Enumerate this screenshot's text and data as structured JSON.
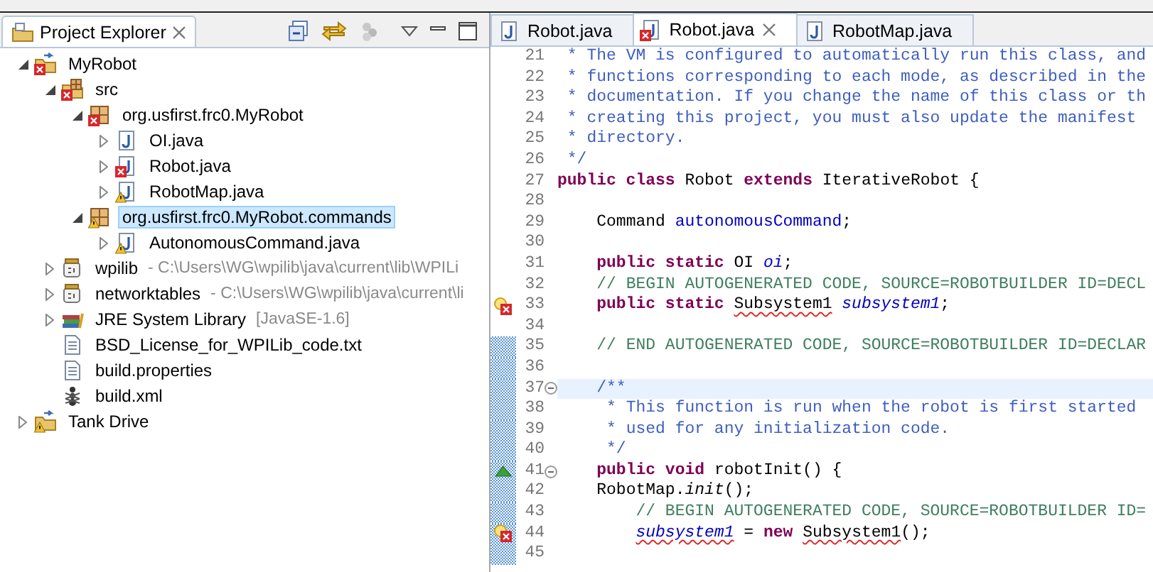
{
  "explorer": {
    "title": "Project Explorer",
    "tree": [
      {
        "label": "MyRobot",
        "kind": "project",
        "has_error": true,
        "has_warning": false,
        "expanded": true,
        "selected": false,
        "children": [
          {
            "label": "src",
            "kind": "source-folder",
            "has_error": true,
            "has_warning": false,
            "expanded": true,
            "selected": false,
            "children": [
              {
                "label": "org.usfirst.frc0.MyRobot",
                "kind": "package",
                "has_error": true,
                "has_warning": false,
                "expanded": true,
                "selected": false,
                "children": [
                  {
                    "label": "OI.java",
                    "kind": "java-file",
                    "has_error": false,
                    "has_warning": false,
                    "expanded": false,
                    "selected": false
                  },
                  {
                    "label": "Robot.java",
                    "kind": "java-file",
                    "has_error": true,
                    "has_warning": false,
                    "expanded": false,
                    "selected": false
                  },
                  {
                    "label": "RobotMap.java",
                    "kind": "java-file",
                    "has_error": false,
                    "has_warning": true,
                    "expanded": false,
                    "selected": false
                  }
                ]
              },
              {
                "label": "org.usfirst.frc0.MyRobot.commands",
                "kind": "package",
                "has_error": false,
                "has_warning": true,
                "expanded": true,
                "selected": true,
                "children": [
                  {
                    "label": "AutonomousCommand.java",
                    "kind": "java-file",
                    "has_error": false,
                    "has_warning": true,
                    "expanded": false,
                    "selected": false
                  }
                ]
              }
            ]
          },
          {
            "label": "wpilib",
            "kind": "library",
            "detail": "- C:\\Users\\WG\\wpilib\\java\\current\\lib\\WPILi",
            "has_error": false,
            "has_warning": false,
            "expanded": false,
            "selected": false
          },
          {
            "label": "networktables",
            "kind": "library",
            "detail": "- C:\\Users\\WG\\wpilib\\java\\current\\li",
            "has_error": false,
            "has_warning": false,
            "expanded": false,
            "selected": false
          },
          {
            "label": "JRE System Library",
            "kind": "jre",
            "detail": "[JavaSE-1.6]",
            "has_error": false,
            "has_warning": false,
            "expanded": false,
            "selected": false
          },
          {
            "label": "BSD_License_for_WPILib_code.txt",
            "kind": "text-file",
            "has_error": false,
            "has_warning": false,
            "selected": false
          },
          {
            "label": "build.properties",
            "kind": "text-file",
            "has_error": false,
            "has_warning": false,
            "selected": false
          },
          {
            "label": "build.xml",
            "kind": "xml-file",
            "has_error": false,
            "has_warning": false,
            "selected": false
          }
        ]
      },
      {
        "label": "Tank Drive",
        "kind": "project",
        "has_error": false,
        "has_warning": true,
        "expanded": false,
        "selected": false
      }
    ]
  },
  "editor": {
    "tabs": [
      {
        "label": "Robot.java",
        "selected": false,
        "has_error": false
      },
      {
        "label": "Robot.java",
        "selected": true,
        "has_error": true
      },
      {
        "label": "RobotMap.java",
        "selected": false,
        "has_error": false
      }
    ],
    "lines": [
      {
        "number": "21",
        "changed": false,
        "current": false,
        "foldable": false,
        "has_error": false,
        "overridden": false,
        "tokens": [
          {
            "kind": "javadoc",
            "text": " * The VM is configured to automatically run this class, and"
          }
        ]
      },
      {
        "number": "22",
        "changed": false,
        "current": false,
        "foldable": false,
        "has_error": false,
        "overridden": false,
        "tokens": [
          {
            "kind": "javadoc",
            "text": " * functions corresponding to each mode, as described in the"
          }
        ]
      },
      {
        "number": "23",
        "changed": false,
        "current": false,
        "foldable": false,
        "has_error": false,
        "overridden": false,
        "tokens": [
          {
            "kind": "javadoc",
            "text": " * documentation. If you change the name of this class or th"
          }
        ]
      },
      {
        "number": "24",
        "changed": false,
        "current": false,
        "foldable": false,
        "has_error": false,
        "overridden": false,
        "tokens": [
          {
            "kind": "javadoc",
            "text": " * creating this project, you must also update the manifest"
          }
        ]
      },
      {
        "number": "25",
        "changed": false,
        "current": false,
        "foldable": false,
        "has_error": false,
        "overridden": false,
        "tokens": [
          {
            "kind": "javadoc",
            "text": " * directory."
          }
        ]
      },
      {
        "number": "26",
        "changed": false,
        "current": false,
        "foldable": false,
        "has_error": false,
        "overridden": false,
        "tokens": [
          {
            "kind": "javadoc",
            "text": " */"
          }
        ]
      },
      {
        "number": "27",
        "changed": false,
        "current": false,
        "foldable": false,
        "has_error": false,
        "overridden": false,
        "tokens": [
          {
            "kind": "keyword",
            "text": "public class"
          },
          {
            "kind": "plain",
            "text": " Robot "
          },
          {
            "kind": "keyword",
            "text": "extends"
          },
          {
            "kind": "plain",
            "text": " IterativeRobot {"
          }
        ]
      },
      {
        "number": "28",
        "changed": false,
        "current": false,
        "foldable": false,
        "has_error": false,
        "overridden": false
      },
      {
        "number": "29",
        "changed": false,
        "current": false,
        "foldable": false,
        "has_error": false,
        "overridden": false,
        "tokens": [
          {
            "kind": "plain",
            "text": "    Command "
          },
          {
            "kind": "field",
            "text": "autonomousCommand"
          },
          {
            "kind": "plain",
            "text": ";"
          }
        ]
      },
      {
        "number": "30",
        "changed": false,
        "current": false,
        "foldable": false,
        "has_error": false,
        "overridden": false
      },
      {
        "number": "31",
        "changed": false,
        "current": false,
        "foldable": false,
        "has_error": false,
        "overridden": false,
        "tokens": [
          {
            "kind": "keyword",
            "text": "    public static"
          },
          {
            "kind": "plain",
            "text": " OI "
          },
          {
            "kind": "static-field",
            "text": "oi"
          },
          {
            "kind": "plain",
            "text": ";"
          }
        ]
      },
      {
        "number": "32",
        "changed": false,
        "current": false,
        "foldable": false,
        "has_error": false,
        "overridden": false,
        "tokens": [
          {
            "kind": "comment",
            "text": "    // BEGIN AUTOGENERATED CODE, SOURCE=ROBOTBUILDER ID=DECL"
          }
        ]
      },
      {
        "number": "33",
        "changed": false,
        "current": false,
        "foldable": false,
        "has_error": true,
        "overridden": false,
        "tokens": [
          {
            "kind": "keyword",
            "text": "    public static"
          },
          {
            "kind": "plain",
            "text": " Subsystem1",
            "squiggle": true
          },
          {
            "kind": "static-field",
            "text": " subsystem1"
          },
          {
            "kind": "plain",
            "text": ";"
          }
        ]
      },
      {
        "number": "34",
        "changed": false,
        "current": false,
        "foldable": false,
        "has_error": false,
        "overridden": false
      },
      {
        "number": "35",
        "changed": true,
        "current": false,
        "foldable": false,
        "has_error": false,
        "overridden": false,
        "tokens": [
          {
            "kind": "comment",
            "text": "    // END AUTOGENERATED CODE, SOURCE=ROBOTBUILDER ID=DECLAR"
          }
        ]
      },
      {
        "number": "36",
        "changed": true,
        "current": false,
        "foldable": false,
        "has_error": false,
        "overridden": false
      },
      {
        "number": "37",
        "changed": true,
        "current": true,
        "foldable": true,
        "has_error": false,
        "overridden": false,
        "tokens": [
          {
            "kind": "javadoc",
            "text": "    /**"
          }
        ]
      },
      {
        "number": "38",
        "changed": true,
        "current": false,
        "foldable": false,
        "has_error": false,
        "overridden": false,
        "tokens": [
          {
            "kind": "javadoc",
            "text": "     * This function is run when the robot is first started"
          }
        ]
      },
      {
        "number": "39",
        "changed": true,
        "current": false,
        "foldable": false,
        "has_error": false,
        "overridden": false,
        "tokens": [
          {
            "kind": "javadoc",
            "text": "     * used for any initialization code."
          }
        ]
      },
      {
        "number": "40",
        "changed": true,
        "current": false,
        "foldable": false,
        "has_error": false,
        "overridden": false,
        "tokens": [
          {
            "kind": "javadoc",
            "text": "     */"
          }
        ]
      },
      {
        "number": "41",
        "changed": true,
        "current": false,
        "foldable": true,
        "has_error": false,
        "overridden": true,
        "tokens": [
          {
            "kind": "keyword",
            "text": "    public void"
          },
          {
            "kind": "plain",
            "text": " robotInit() {"
          }
        ]
      },
      {
        "number": "42",
        "changed": true,
        "current": false,
        "foldable": false,
        "has_error": false,
        "overridden": false,
        "tokens": [
          {
            "kind": "plain",
            "text": "    RobotMap."
          },
          {
            "kind": "static-method",
            "text": "init"
          },
          {
            "kind": "plain",
            "text": "();"
          }
        ]
      },
      {
        "number": "43",
        "changed": true,
        "current": false,
        "foldable": false,
        "has_error": false,
        "overridden": false,
        "tokens": [
          {
            "kind": "comment",
            "text": "        // BEGIN AUTOGENERATED CODE, SOURCE=ROBOTBUILDER ID="
          }
        ]
      },
      {
        "number": "44",
        "changed": true,
        "current": false,
        "foldable": false,
        "has_error": true,
        "overridden": false,
        "tokens": [
          {
            "kind": "static-field",
            "text": "        subsystem1",
            "squiggle": true
          },
          {
            "kind": "plain",
            "text": " = "
          },
          {
            "kind": "keyword",
            "text": "new"
          },
          {
            "kind": "plain",
            "text": " Subsystem1",
            "squiggle": true
          },
          {
            "kind": "plain",
            "text": "();"
          }
        ]
      },
      {
        "number": "45",
        "changed": true,
        "current": false,
        "foldable": false,
        "has_error": false,
        "overridden": false
      }
    ]
  }
}
